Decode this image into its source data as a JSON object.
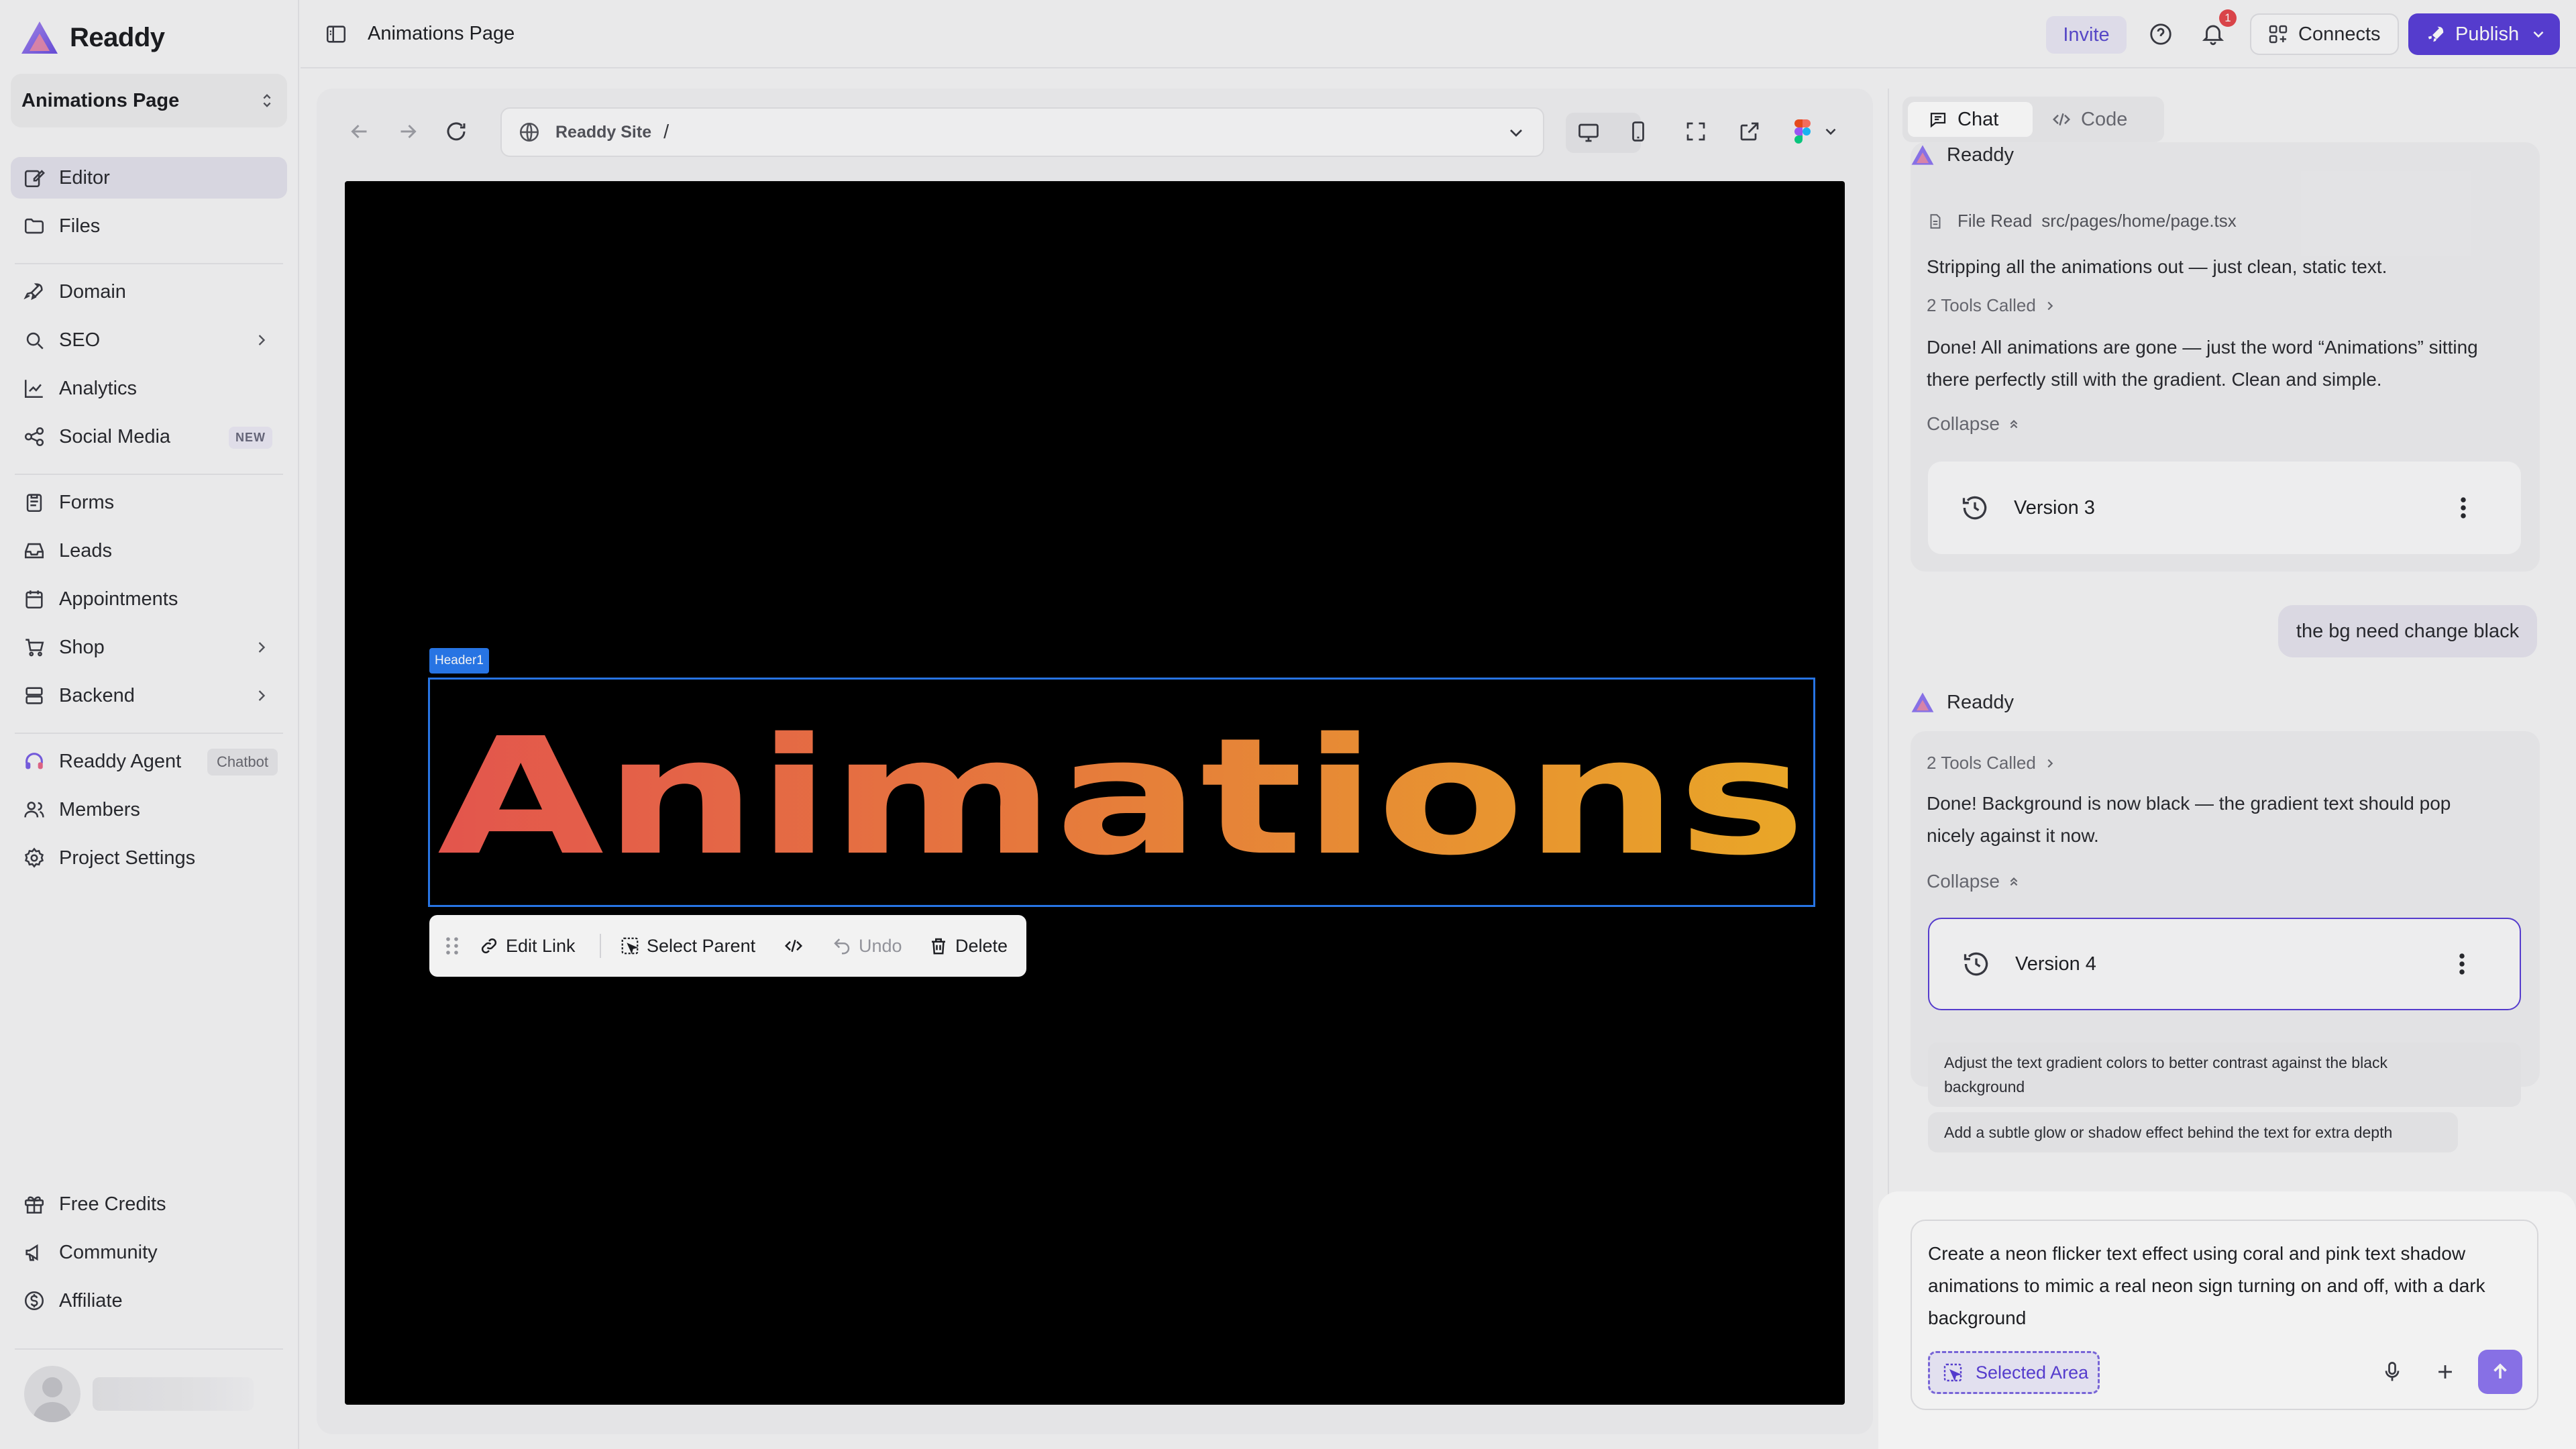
{
  "brand": {
    "name": "Readdy"
  },
  "project_selector": {
    "label": "Animations Page"
  },
  "sidebar": {
    "items": [
      {
        "label": "Editor",
        "icon": "edit-icon"
      },
      {
        "label": "Files",
        "icon": "folder-icon"
      },
      {
        "label": "Domain",
        "icon": "rocket-icon"
      },
      {
        "label": "SEO",
        "icon": "search-icon"
      },
      {
        "label": "Analytics",
        "icon": "chart-icon"
      },
      {
        "label": "Social Media",
        "icon": "share-icon",
        "badge": "NEW"
      },
      {
        "label": "Forms",
        "icon": "clipboard-icon"
      },
      {
        "label": "Leads",
        "icon": "inbox-icon"
      },
      {
        "label": "Appointments",
        "icon": "calendar-icon"
      },
      {
        "label": "Shop",
        "icon": "cart-icon"
      },
      {
        "label": "Backend",
        "icon": "server-icon"
      },
      {
        "label": "Readdy Agent",
        "icon": "headset-icon",
        "badge": "Chatbot"
      },
      {
        "label": "Members",
        "icon": "users-icon"
      },
      {
        "label": "Project Settings",
        "icon": "gear-icon"
      },
      {
        "label": "Free Credits",
        "icon": "gift-icon"
      },
      {
        "label": "Community",
        "icon": "megaphone-icon"
      },
      {
        "label": "Affiliate",
        "icon": "dollar-icon"
      }
    ]
  },
  "topbar": {
    "page_title": "Animations Page",
    "invite_label": "Invite",
    "notification_count": "1",
    "connects_label": "Connects",
    "publish_label": "Publish"
  },
  "browser": {
    "site_label": "Readdy Site",
    "path": "/"
  },
  "canvas": {
    "selected_tag": "Header1",
    "hero_text": "Animations",
    "gradient_start": "#f05a52",
    "gradient_end": "#f6b02a",
    "toolbar": {
      "edit_link": "Edit Link",
      "select_parent": "Select Parent",
      "undo": "Undo",
      "delete": "Delete"
    }
  },
  "chat": {
    "tabs": [
      {
        "label": "Chat"
      },
      {
        "label": "Code"
      }
    ],
    "agent_name": "Readdy",
    "file_read_label": "File Read",
    "file_read_path": "src/pages/home/page.tsx",
    "msg1_intro": "Stripping all the animations out — just clean, static text.",
    "tools_called": "2 Tools Called",
    "msg1_done_line1": "Done! All animations are gone — just the word “Animations” sitting",
    "msg1_done_line2": "there perfectly still with the gradient. Clean and simple.",
    "collapse_label": "Collapse",
    "version3_label": "Version 3",
    "user_message": "the bg need change black",
    "msg2_done_line1": "Done! Background is now black — the gradient text should pop",
    "msg2_done_line2": "nicely against it now.",
    "version4_label": "Version 4",
    "suggestion1_line1": "Adjust the text gradient colors to better contrast against the black",
    "suggestion1_line2": "background",
    "suggestion2": "Add a subtle glow or shadow effect behind the text for extra depth",
    "input_line1": "Create a neon flicker text effect using coral and pink text shadow",
    "input_line2": "animations to mimic a real neon sign turning on and off, with a dark",
    "input_line3": "background",
    "selected_area_label": "Selected Area",
    "accent_color": "#5a40d8"
  }
}
